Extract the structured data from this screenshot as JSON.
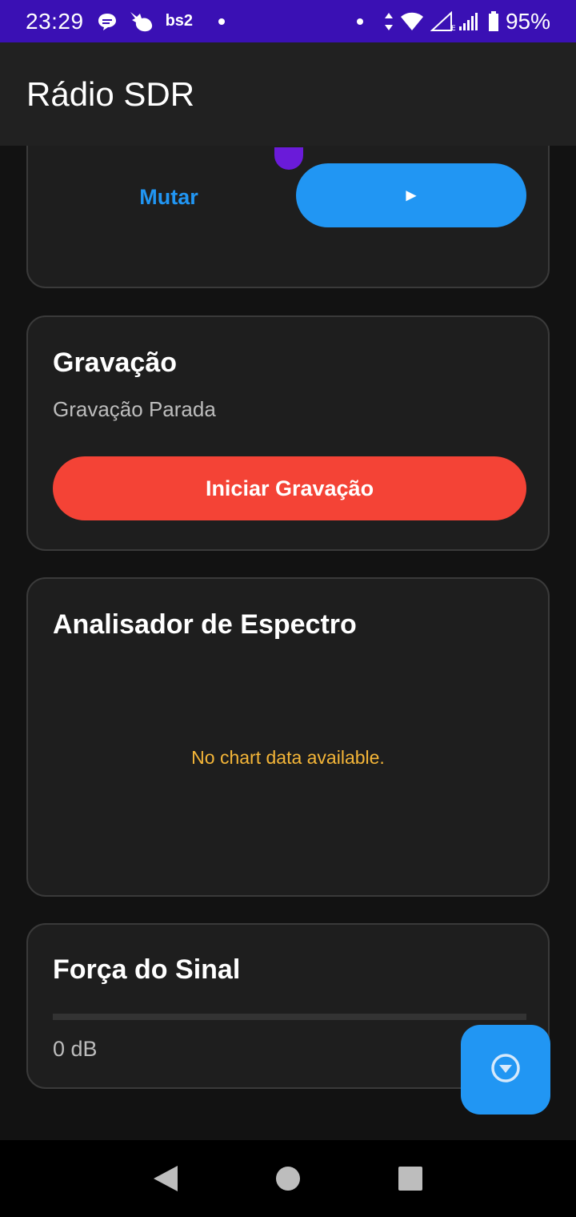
{
  "status_bar": {
    "time": "23:29",
    "carrier_text": "bs2",
    "battery": "95%",
    "icons": [
      "chat-bubble-icon",
      "bird-icon",
      "notification-dot-icon",
      "data-arrows-icon",
      "wifi-icon",
      "signal-icon",
      "battery-icon"
    ]
  },
  "app_bar": {
    "title": "Rádio SDR"
  },
  "player_card": {
    "mute_label": "Mutar",
    "play_label": "►"
  },
  "recording_card": {
    "title": "Gravação",
    "status": "Gravação Parada",
    "button_label": "Iniciar Gravação"
  },
  "spectrum_card": {
    "title": "Analisador de Espectro",
    "empty_message": "No chart data available."
  },
  "signal_card": {
    "title": "Força do Sinal",
    "level_fraction": 0,
    "value_text": "0 dB"
  },
  "fab": {
    "icon": "chevron-down-circle-icon"
  },
  "nav_bar": {
    "icons": [
      "back-icon",
      "home-icon",
      "recents-icon"
    ]
  },
  "colors": {
    "status_bar": "#3a10b4",
    "accent": "#2196f3",
    "record": "#f44336",
    "warning_text": "#f5b638",
    "card_bg": "#1e1e1e",
    "page_bg": "#121212"
  }
}
